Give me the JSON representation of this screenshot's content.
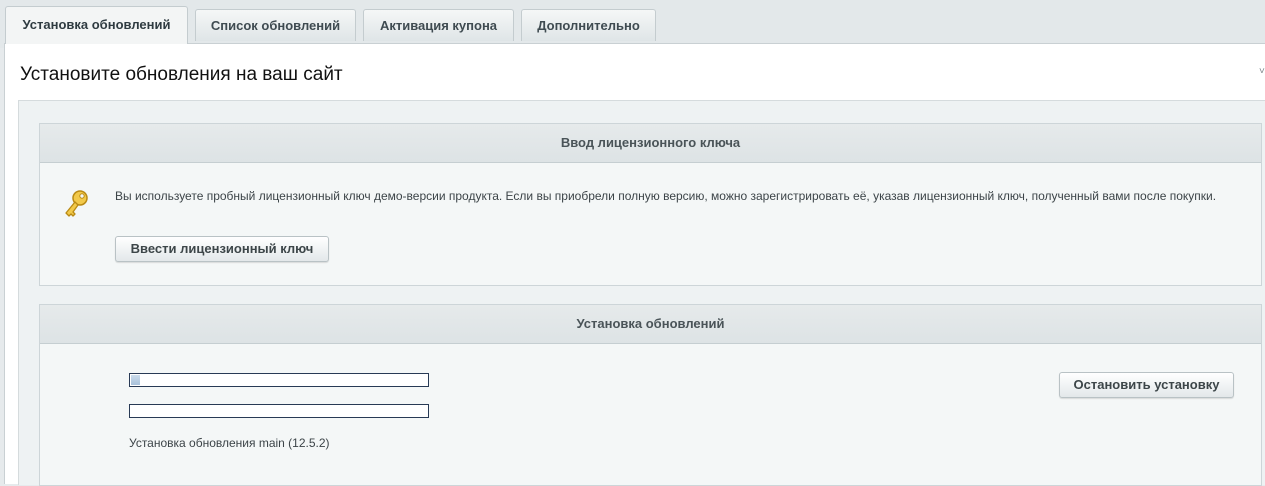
{
  "tabs": [
    {
      "label": "Установка обновлений",
      "active": true
    },
    {
      "label": "Список обновлений",
      "active": false
    },
    {
      "label": "Активация купона",
      "active": false
    },
    {
      "label": "Дополнительно",
      "active": false
    }
  ],
  "page_title": "Установите обновления на ваш сайт",
  "license_section": {
    "title": "Ввод лицензионного ключа",
    "icon": "key-icon",
    "notice": "Вы используете пробный лицензионный ключ демо-версии продукта. Если вы приобрели полную версию, можно зарегистрировать её, указав лицензионный ключ, полученный вами после покупки.",
    "button_label": "Ввести лицензионный ключ"
  },
  "install_section": {
    "title": "Установка обновлений",
    "progress_overall_fraction": 0.03,
    "progress_current_fraction": 0.0,
    "status": "Установка обновления main (12.5.2)",
    "stop_button_label": "Остановить установку"
  },
  "colors": {
    "progress_border": "#283a55",
    "progress_fill": "#a8c1da",
    "panel_background": "#eef2f3"
  }
}
